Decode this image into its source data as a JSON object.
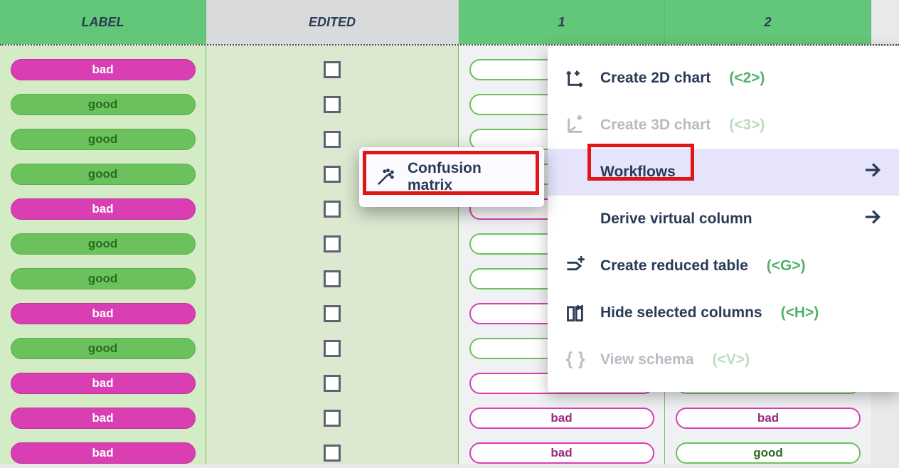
{
  "columns": {
    "label": "LABEL",
    "edited": "EDITED",
    "c1": "1",
    "c2": "2"
  },
  "pill_text": {
    "good": "good",
    "bad": "bad"
  },
  "label_col": [
    "bad",
    "good",
    "good",
    "good",
    "bad",
    "good",
    "good",
    "bad",
    "good",
    "bad",
    "bad",
    "bad"
  ],
  "col1": [
    "",
    "",
    "",
    "",
    "",
    "",
    "",
    "",
    "",
    "bad",
    "bad",
    "bad"
  ],
  "col2": [
    "",
    "",
    "",
    "",
    "",
    "",
    "",
    "",
    "",
    "good",
    "bad",
    "good"
  ],
  "menu": {
    "create2d": {
      "label": "Create 2D chart",
      "shortcut": "(<2>)"
    },
    "create3d": {
      "label": "Create 3D chart",
      "shortcut": "(<3>)"
    },
    "workflows": {
      "label": "Workflows"
    },
    "derive": {
      "label": "Derive virtual column"
    },
    "reduced": {
      "label": "Create reduced table",
      "shortcut": "(<G>)"
    },
    "hide": {
      "label": "Hide selected columns",
      "shortcut": "(<H>)"
    },
    "schema": {
      "label": "View schema",
      "shortcut": "(<V>)"
    }
  },
  "submenu": {
    "confusion": "Confusion matrix"
  }
}
